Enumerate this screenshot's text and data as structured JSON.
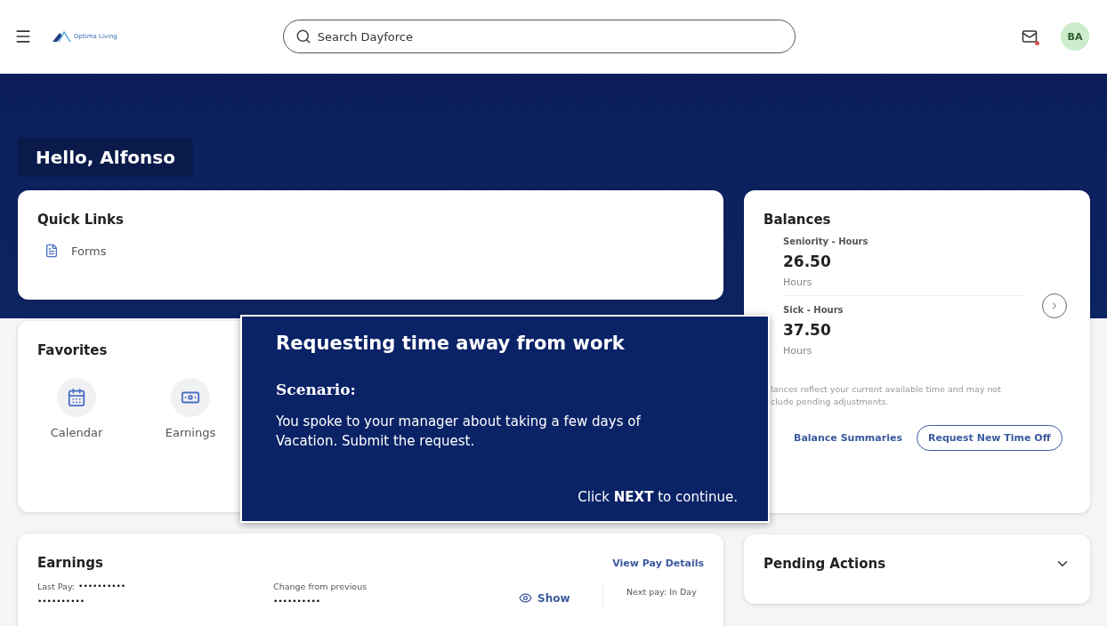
{
  "header": {
    "logo_text": "Optima Living",
    "search": {
      "placeholder": "Search Dayforce"
    },
    "mail_unread": true,
    "avatar": "BA"
  },
  "greeting": "Hello, Alfonso",
  "quick_links": {
    "title": "Quick Links",
    "items": [
      {
        "label": "Forms"
      }
    ]
  },
  "favorites": {
    "title": "Favorites",
    "items": [
      {
        "label": "Calendar",
        "kind": "calendar"
      },
      {
        "label": "Earnings",
        "kind": "earnings"
      }
    ]
  },
  "balances": {
    "title": "Balances",
    "items": [
      {
        "label": "Seniority - Hours",
        "value": "26.50",
        "unit": "Hours"
      },
      {
        "label": "Sick - Hours",
        "value": "37.50",
        "unit": "Hours"
      }
    ],
    "note_lines": [
      "lances reflect your current available time and may not",
      "clude pending adjustments."
    ],
    "links": [
      {
        "label": "Balance Summaries",
        "kind": "link"
      },
      {
        "label": "Request New Time Off",
        "kind": "outlined"
      }
    ]
  },
  "earnings": {
    "title": "Earnings",
    "link": "View Pay Details",
    "last_pay_label": "Last Pay:",
    "last_pay_mask": "••••••••••",
    "last_pay_mask2": "••••••••••",
    "change_label": "Change from previous",
    "change_mask": "••••••••••",
    "show": "Show",
    "next_pay": "Next pay: In Day"
  },
  "pending_actions": {
    "title": "Pending Actions",
    "expanded": false
  },
  "tutorial": {
    "title": "Requesting time away from work",
    "subtitle": "Scenario:",
    "body": "You spoke to your manager about taking a few days of Vacation. Submit the request.",
    "footer": "Click **NEXT** to continue."
  }
}
